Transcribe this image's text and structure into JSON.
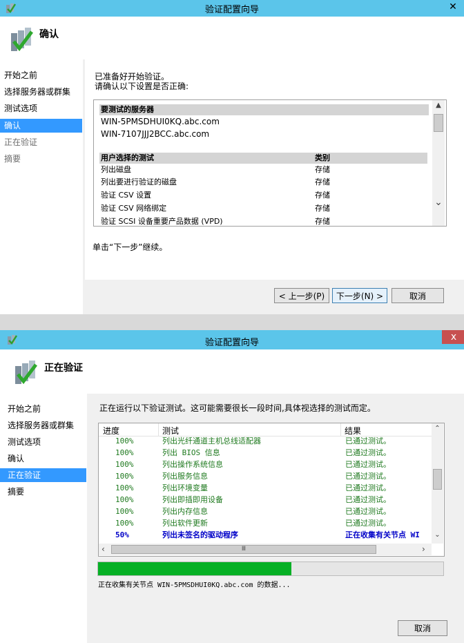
{
  "window1": {
    "title": "验证配置向导",
    "close_label": "✕",
    "header_title": "确认",
    "nav": [
      "开始之前",
      "选择服务器或群集",
      "测试选项",
      "确认",
      "正在验证",
      "摘要"
    ],
    "intro_line1": "已准备好开始验证。",
    "intro_line2": "请确认以下设置是否正确:",
    "servers_header": "要测试的服务器",
    "servers": [
      "WIN-5PMSDHUI0KQ.abc.com",
      "WIN-7107JJJ2BCC.abc.com"
    ],
    "tests_header": "用户选择的测试",
    "category_header": "类别",
    "tests": [
      {
        "name": "列出磁盘",
        "category": "存储"
      },
      {
        "name": "列出要进行验证的磁盘",
        "category": "存储"
      },
      {
        "name": "验证 CSV 设置",
        "category": "存储"
      },
      {
        "name": "验证 CSV 网络绑定",
        "category": "存储"
      },
      {
        "name": "验证 SCSI 设备重要产品数据 (VPD)",
        "category": "存储"
      }
    ],
    "next_hint": "单击“下一步”继续。",
    "back_button": "< 上一步(P)",
    "next_button": "下一步(N) >",
    "cancel_button": "取消"
  },
  "window2": {
    "title": "验证配置向导",
    "close_label": "x",
    "header_title": "正在验证",
    "nav": [
      "开始之前",
      "选择服务器或群集",
      "测试选项",
      "确认",
      "正在验证",
      "摘要"
    ],
    "status_text": "正在运行以下验证测试。这可能需要很长一段时间,具体视选择的测试而定。",
    "col_progress": "进度",
    "col_test": "测试",
    "col_result": "结果",
    "rows": [
      {
        "progress": "100%",
        "test": "列出光纤通道主机总线适配器",
        "result": "已通过测试。"
      },
      {
        "progress": "100%",
        "test": "列出 BIOS 信息",
        "result": "已通过测试。"
      },
      {
        "progress": "100%",
        "test": "列出操作系统信息",
        "result": "已通过测试。"
      },
      {
        "progress": "100%",
        "test": "列出服务信息",
        "result": "已通过测试。"
      },
      {
        "progress": "100%",
        "test": "列出环境变量",
        "result": "已通过测试。"
      },
      {
        "progress": "100%",
        "test": "列出即插即用设备",
        "result": "已通过测试。"
      },
      {
        "progress": "100%",
        "test": "列出内存信息",
        "result": "已通过测试。"
      },
      {
        "progress": "100%",
        "test": "列出软件更新",
        "result": "已通过测试。"
      },
      {
        "progress": "50%",
        "test": "列出未签名的驱动程序",
        "result": "正在收集有关节点 WI"
      }
    ],
    "progress_fraction": 0.56,
    "progress_status": "正在收集有关节点 WIN-5PMSDHUI0KQ.abc.com 的数据...",
    "hscroll_grip": "Ⅲ",
    "cancel_button": "取消"
  },
  "colors": {
    "titlebar": "#5bc5ea",
    "nav_active": "#3399ff",
    "progress_fill": "#06b025",
    "close": "#c75050"
  }
}
